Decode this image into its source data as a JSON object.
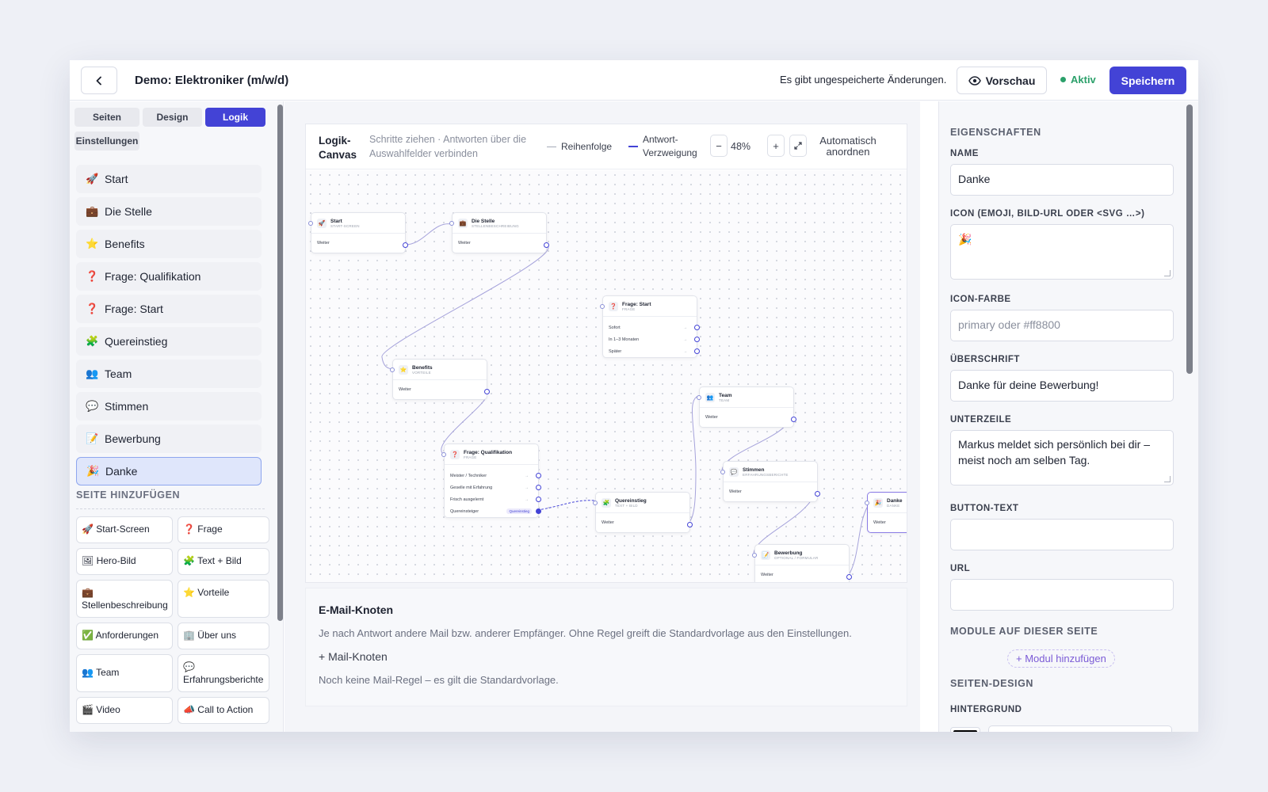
{
  "header": {
    "back_icon": "chevron-left-icon",
    "title": "Demo: Elektroniker (m/w/d)",
    "unsaved": "Es gibt ungespeicherte Änderungen.",
    "preview_label": "Vorschau",
    "status_label": "Aktiv",
    "save_label": "Speichern",
    "status_color": "#2ba06a",
    "accent_color": "#4343d6"
  },
  "sidebar": {
    "tabs": [
      "Seiten",
      "Design",
      "Logik",
      "Einstellungen"
    ],
    "active_tab": "Logik",
    "pages": [
      {
        "icon": "🚀",
        "label": "Start"
      },
      {
        "icon": "💼",
        "label": "Die Stelle"
      },
      {
        "icon": "⭐",
        "label": "Benefits"
      },
      {
        "icon": "❓",
        "label": "Frage: Qualifikation"
      },
      {
        "icon": "❓",
        "label": "Frage: Start"
      },
      {
        "icon": "🧩",
        "label": "Quereinstieg"
      },
      {
        "icon": "👥",
        "label": "Team"
      },
      {
        "icon": "💬",
        "label": "Stimmen"
      },
      {
        "icon": "📝",
        "label": "Bewerbung"
      },
      {
        "icon": "🎉",
        "label": "Danke"
      }
    ],
    "selected_page": "Danke",
    "add_title": "SEITE HINZUFÜGEN",
    "add_items": [
      {
        "icon": "🚀",
        "label": "Start-Screen"
      },
      {
        "icon": "❓",
        "label": "Frage"
      },
      {
        "icon": "🖼",
        "label": "Hero-Bild"
      },
      {
        "icon": "🧩",
        "label": "Text + Bild"
      },
      {
        "icon": "💼",
        "label": "Stellenbeschreibung"
      },
      {
        "icon": "⭐",
        "label": "Vorteile"
      },
      {
        "icon": "✅",
        "label": "Anforderungen"
      },
      {
        "icon": "🏢",
        "label": "Über uns"
      },
      {
        "icon": "👥",
        "label": "Team"
      },
      {
        "icon": "💬",
        "label": "Erfahrungsberichte"
      },
      {
        "icon": "🎬",
        "label": "Video"
      },
      {
        "icon": "📣",
        "label": "Call to Action"
      }
    ]
  },
  "canvas": {
    "title": "Logik-Canvas",
    "hint": "Schritte ziehen · Antworten über die Auswahlfelder verbinden",
    "legend_order": "Reihenfolge",
    "legend_branch": "Antwort-Verzweigung",
    "zoom_minus": "−",
    "zoom": "48%",
    "zoom_plus": "+",
    "fit_icon": "expand-icon",
    "auto_arrange": "Automatisch anordnen",
    "nodes": {
      "start": {
        "icon": "🚀",
        "name": "Start",
        "sub": "START-SCREEN",
        "row": "Weiter"
      },
      "stelle": {
        "icon": "💼",
        "name": "Die Stelle",
        "sub": "STELLENBESCHREIBUNG",
        "row": "Weiter"
      },
      "frage_start": {
        "icon": "❓",
        "name": "Frage: Start",
        "sub": "FRAGE",
        "rows": [
          "Sofort",
          "In 1–3 Monaten",
          "Später"
        ]
      },
      "benefits": {
        "icon": "⭐",
        "name": "Benefits",
        "sub": "VORTEILE",
        "row": "Weiter"
      },
      "team": {
        "icon": "👥",
        "name": "Team",
        "sub": "TEAM",
        "row": "Weiter"
      },
      "frage_qual": {
        "icon": "❓",
        "name": "Frage: Qualifikation",
        "sub": "FRAGE",
        "rows": [
          "Meister / Techniker",
          "Geselle mit Erfahrung",
          "Frisch ausgelernt",
          "Quereinsteiger"
        ],
        "tag": "Quereinstieg"
      },
      "stimmen": {
        "icon": "💬",
        "name": "Stimmen",
        "sub": "ERFAHRUNGSBERICHTE",
        "row": "Weiter"
      },
      "quereinstieg": {
        "icon": "🧩",
        "name": "Quereinstieg",
        "sub": "TEXT + BILD",
        "row": "Weiter"
      },
      "bewerbung": {
        "icon": "📝",
        "name": "Bewerbung",
        "sub": "OPTIONAL / FORMULAR",
        "row": "Weiter"
      },
      "danke": {
        "icon": "🎉",
        "name": "Danke",
        "sub": "DANKE",
        "row": "Weiter"
      }
    }
  },
  "mail": {
    "title": "E-Mail-Knoten",
    "description": "Je nach Antwort andere Mail bzw. anderer Empfänger. Ohne Regel greift die Standardvorlage aus den Einstellungen.",
    "add_label": "+ Mail-Knoten",
    "empty": "Noch keine Mail-Regel – es gilt die Standardvorlage."
  },
  "properties": {
    "heading": "EIGENSCHAFTEN",
    "name_label": "NAME",
    "name_value": "Danke",
    "icon_label": "ICON (EMOJI, BILD-URL ODER <SVG …>)",
    "icon_value": "🎉",
    "icon_color_label": "ICON-FARBE",
    "icon_color_placeholder": "primary oder #ff8800",
    "headline_label": "ÜBERSCHRIFT",
    "headline_value": "Danke für deine Bewerbung!",
    "subline_label": "UNTERZEILE",
    "subline_value": "Markus meldet sich persönlich bei dir – meist noch am selben Tag.",
    "button_text_label": "BUTTON-TEXT",
    "button_text_value": "",
    "url_label": "URL",
    "url_value": "",
    "modules_heading": "MODULE AUF DIESER SEITE",
    "add_module": "+ Modul hinzufügen",
    "design_heading": "SEITEN-DESIGN",
    "background_label": "HINTERGRUND",
    "background_color": "#000000"
  }
}
